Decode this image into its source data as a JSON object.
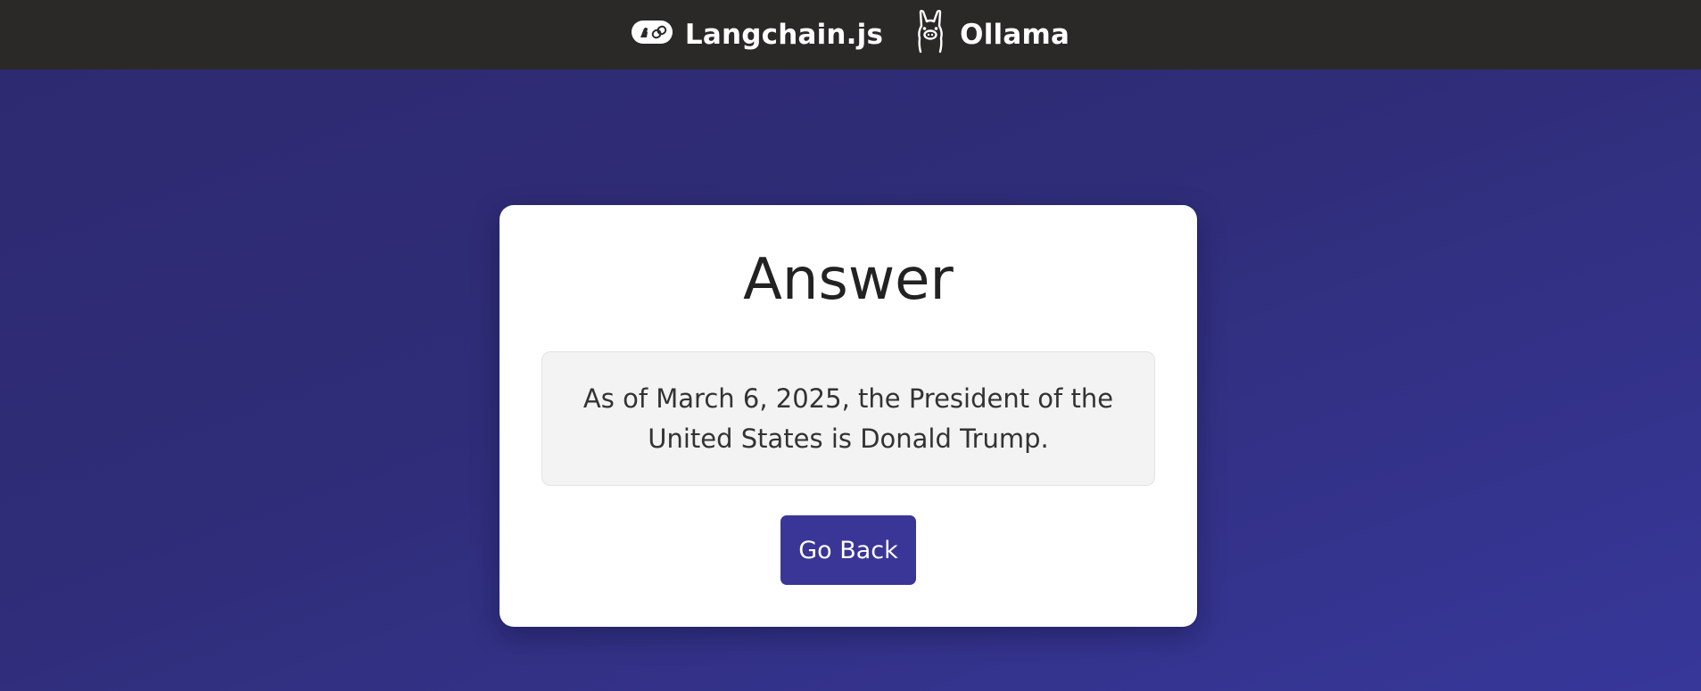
{
  "header": {
    "brands": [
      {
        "label": "Langchain.js",
        "icon": "langchain-icon"
      },
      {
        "label": "Ollama",
        "icon": "llama-icon"
      }
    ],
    "background_color": "#2a2928"
  },
  "card": {
    "title": "Answer",
    "answer": "As of March 6, 2025, the President of the United States is Donald Trump.",
    "go_back_label": "Go Back"
  },
  "colors": {
    "page_gradient_start": "#2e2a70",
    "page_gradient_end": "#37379a",
    "button": "#3a3698",
    "answer_box": "#f3f3f3"
  }
}
